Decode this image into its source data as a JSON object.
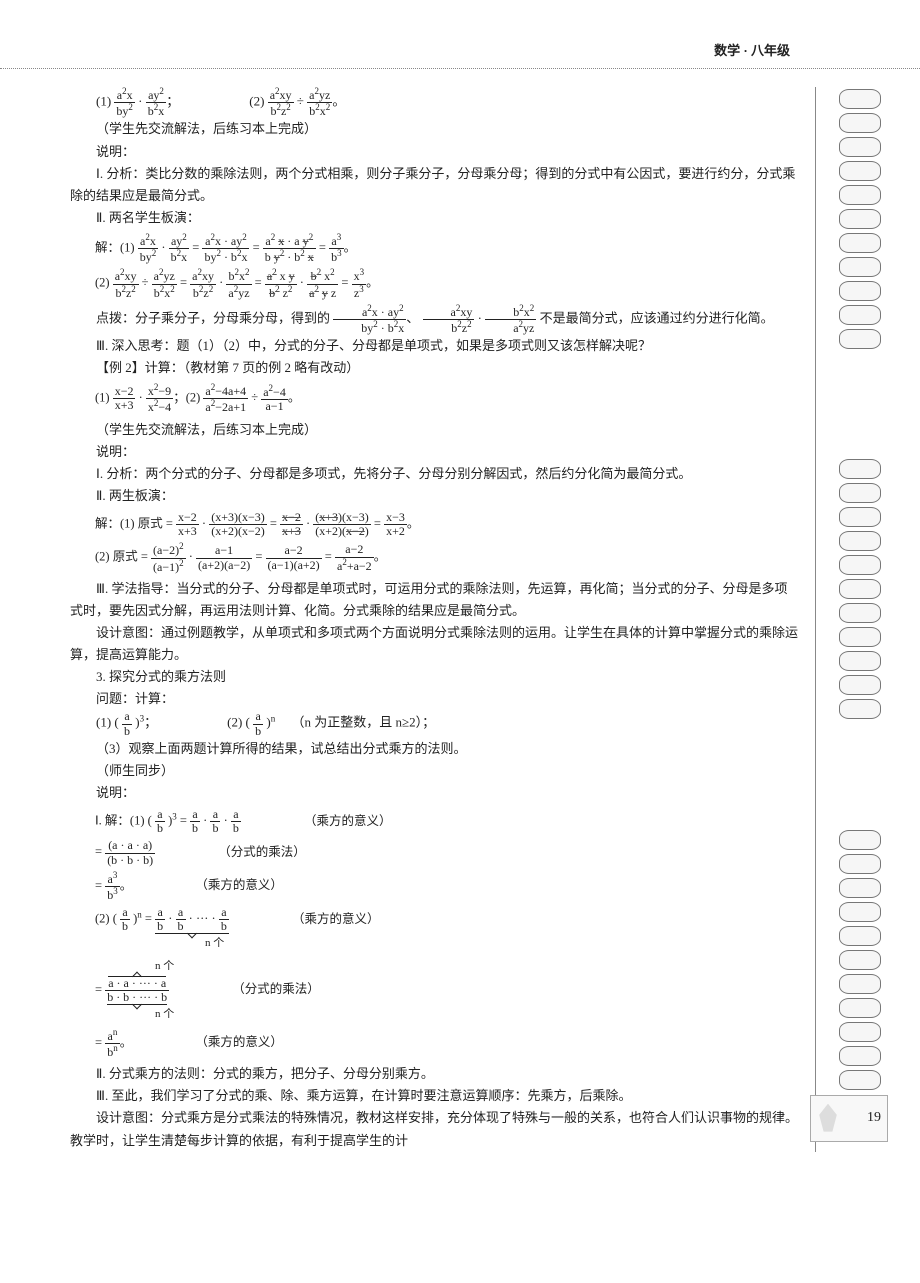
{
  "header": {
    "subject": "数学 · 八年级"
  },
  "page_number": "19",
  "lines": {
    "l1a": "（学生先交流解法，后练习本上完成）",
    "l1b": "说明：",
    "l2": "Ⅰ. 分析：类比分数的乘除法则，两个分式相乘，则分子乘分子，分母乘分母；得到的分式中有公因式，要进行约分，分式乘除的结果应是最简分式。",
    "l3": "Ⅱ. 两名学生板演：",
    "l4": "不是最简分式，应该通过约分进行化简。",
    "l5": "Ⅲ. 深入思考：题（1）（2）中，分式的分子、分母都是单项式，如果是多项式则又该怎样解决呢？",
    "l6": "【例 2】计算：（教材第 7 页的例 2 略有改动）",
    "l7": "（学生先交流解法，后练习本上完成）",
    "l8": "说明：",
    "l9": "Ⅰ. 分析：两个分式的分子、分母都是多项式，先将分子、分母分别分解因式，然后约分化简为最简分式。",
    "l10": "Ⅱ. 两生板演：",
    "l11": "Ⅲ. 学法指导：当分式的分子、分母都是单项式时，可运用分式的乘除法则，先运算，再化简；当分式的分子、分母是多项式时，要先因式分解，再运用法则计算、化简。分式乘除的结果应是最简分式。",
    "l12": "设计意图：通过例题教学，从单项式和多项式两个方面说明分式乘除法则的运用。让学生在具体的计算中掌握分式的乘除运算，提高运算能力。",
    "l13": "3. 探究分式的乘方法则",
    "l14": "问题：计算：",
    "l15": "（n 为正整数，且 n≥2）；",
    "l16": "（3）观察上面两题计算所得的结果，试总结出分式乘方的法则。",
    "l17": "（师生同步）",
    "l18": "说明：",
    "n1": "（乘方的意义）",
    "n2": "（分式的乘法）",
    "n3": "（乘方的意义）",
    "n4": "（乘方的意义）",
    "n5": "（分式的乘法）",
    "n6": "（乘方的意义）",
    "sub1": "n 个",
    "sub2": "n 个",
    "sub3": "n 个",
    "l19": "Ⅱ. 分式乘方的法则：分式的乘方，把分子、分母分别乘方。",
    "l20": "Ⅲ. 至此，我们学习了分式的乘、除、乘方运算，在计算时要注意运算顺序：先乘方，后乘除。",
    "l21": "设计意图：分式乘方是分式乘法的特殊情况，教材这样安排，充分体现了特殊与一般的关系，也符合人们认识事物的规律。教学时，让学生清楚每步计算的依据，有利于提高学生的计"
  }
}
